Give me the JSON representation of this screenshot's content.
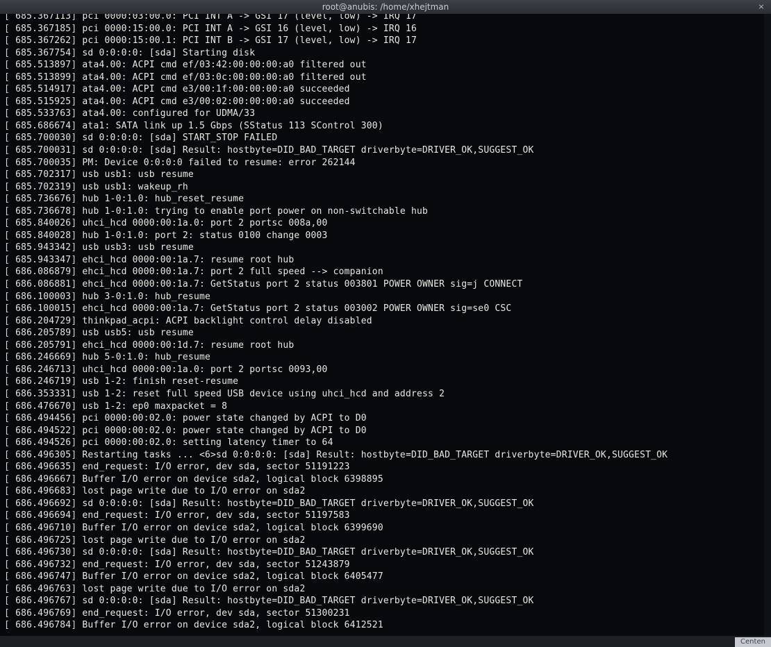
{
  "window": {
    "title": "root@anubis: /home/xhejtman",
    "close_label": "×"
  },
  "status": {
    "corner_label": "Centen"
  },
  "terminal": {
    "lines": [
      {
        "ts": "685.367113",
        "msg": "pci 0000:03:00.0: PCI INT A -> GSI 17 (level, low) -> IRQ 17"
      },
      {
        "ts": "685.367185",
        "msg": "pci 0000:15:00.0: PCI INT A -> GSI 16 (level, low) -> IRQ 16"
      },
      {
        "ts": "685.367262",
        "msg": "pci 0000:15:00.1: PCI INT B -> GSI 17 (level, low) -> IRQ 17"
      },
      {
        "ts": "685.367754",
        "msg": "sd 0:0:0:0: [sda] Starting disk"
      },
      {
        "ts": "685.513897",
        "msg": "ata4.00: ACPI cmd ef/03:42:00:00:00:a0 filtered out"
      },
      {
        "ts": "685.513899",
        "msg": "ata4.00: ACPI cmd ef/03:0c:00:00:00:a0 filtered out"
      },
      {
        "ts": "685.514917",
        "msg": "ata4.00: ACPI cmd e3/00:1f:00:00:00:a0 succeeded"
      },
      {
        "ts": "685.515925",
        "msg": "ata4.00: ACPI cmd e3/00:02:00:00:00:a0 succeeded"
      },
      {
        "ts": "685.533763",
        "msg": "ata4.00: configured for UDMA/33"
      },
      {
        "ts": "685.686674",
        "msg": "ata1: SATA link up 1.5 Gbps (SStatus 113 SControl 300)"
      },
      {
        "ts": "685.700030",
        "msg": "sd 0:0:0:0: [sda] START_STOP FAILED"
      },
      {
        "ts": "685.700031",
        "msg": "sd 0:0:0:0: [sda] Result: hostbyte=DID_BAD_TARGET driverbyte=DRIVER_OK,SUGGEST_OK"
      },
      {
        "ts": "685.700035",
        "msg": "PM: Device 0:0:0:0 failed to resume: error 262144"
      },
      {
        "ts": "685.702317",
        "msg": "usb usb1: usb resume"
      },
      {
        "ts": "685.702319",
        "msg": "usb usb1: wakeup_rh"
      },
      {
        "ts": "685.736676",
        "msg": "hub 1-0:1.0: hub_reset_resume"
      },
      {
        "ts": "685.736678",
        "msg": "hub 1-0:1.0: trying to enable port power on non-switchable hub"
      },
      {
        "ts": "685.840026",
        "msg": "uhci_hcd 0000:00:1a.0: port 2 portsc 008a,00"
      },
      {
        "ts": "685.840028",
        "msg": "hub 1-0:1.0: port 2: status 0100 change 0003"
      },
      {
        "ts": "685.943342",
        "msg": "usb usb3: usb resume"
      },
      {
        "ts": "685.943347",
        "msg": "ehci_hcd 0000:00:1a.7: resume root hub"
      },
      {
        "ts": "686.086879",
        "msg": "ehci_hcd 0000:00:1a.7: port 2 full speed --> companion"
      },
      {
        "ts": "686.086881",
        "msg": "ehci_hcd 0000:00:1a.7: GetStatus port 2 status 003801 POWER OWNER sig=j CONNECT"
      },
      {
        "ts": "686.100003",
        "msg": "hub 3-0:1.0: hub_resume"
      },
      {
        "ts": "686.100015",
        "msg": "ehci_hcd 0000:00:1a.7: GetStatus port 2 status 003002 POWER OWNER sig=se0 CSC"
      },
      {
        "ts": "686.204729",
        "msg": "thinkpad_acpi: ACPI backlight control delay disabled"
      },
      {
        "ts": "686.205789",
        "msg": "usb usb5: usb resume"
      },
      {
        "ts": "686.205791",
        "msg": "ehci_hcd 0000:00:1d.7: resume root hub"
      },
      {
        "ts": "686.246669",
        "msg": "hub 5-0:1.0: hub_resume"
      },
      {
        "ts": "686.246713",
        "msg": "uhci_hcd 0000:00:1a.0: port 2 portsc 0093,00"
      },
      {
        "ts": "686.246719",
        "msg": "usb 1-2: finish reset-resume"
      },
      {
        "ts": "686.353331",
        "msg": "usb 1-2: reset full speed USB device using uhci_hcd and address 2"
      },
      {
        "ts": "686.476670",
        "msg": "usb 1-2: ep0 maxpacket = 8"
      },
      {
        "ts": "686.494456",
        "msg": "pci 0000:00:02.0: power state changed by ACPI to D0"
      },
      {
        "ts": "686.494522",
        "msg": "pci 0000:00:02.0: power state changed by ACPI to D0"
      },
      {
        "ts": "686.494526",
        "msg": "pci 0000:00:02.0: setting latency timer to 64"
      },
      {
        "ts": "686.496305",
        "msg": "Restarting tasks ... <6>sd 0:0:0:0: [sda] Result: hostbyte=DID_BAD_TARGET driverbyte=DRIVER_OK,SUGGEST_OK"
      },
      {
        "ts": "686.496635",
        "msg": "end_request: I/O error, dev sda, sector 51191223"
      },
      {
        "ts": "686.496667",
        "msg": "Buffer I/O error on device sda2, logical block 6398895"
      },
      {
        "ts": "686.496683",
        "msg": "lost page write due to I/O error on sda2"
      },
      {
        "ts": "686.496692",
        "msg": "sd 0:0:0:0: [sda] Result: hostbyte=DID_BAD_TARGET driverbyte=DRIVER_OK,SUGGEST_OK"
      },
      {
        "ts": "686.496694",
        "msg": "end_request: I/O error, dev sda, sector 51197583"
      },
      {
        "ts": "686.496710",
        "msg": "Buffer I/O error on device sda2, logical block 6399690"
      },
      {
        "ts": "686.496725",
        "msg": "lost page write due to I/O error on sda2"
      },
      {
        "ts": "686.496730",
        "msg": "sd 0:0:0:0: [sda] Result: hostbyte=DID_BAD_TARGET driverbyte=DRIVER_OK,SUGGEST_OK"
      },
      {
        "ts": "686.496732",
        "msg": "end_request: I/O error, dev sda, sector 51243879"
      },
      {
        "ts": "686.496747",
        "msg": "Buffer I/O error on device sda2, logical block 6405477"
      },
      {
        "ts": "686.496763",
        "msg": "lost page write due to I/O error on sda2"
      },
      {
        "ts": "686.496767",
        "msg": "sd 0:0:0:0: [sda] Result: hostbyte=DID_BAD_TARGET driverbyte=DRIVER_OK,SUGGEST_OK"
      },
      {
        "ts": "686.496769",
        "msg": "end_request: I/O error, dev sda, sector 51300231"
      },
      {
        "ts": "686.496784",
        "msg": "Buffer I/O error on device sda2, logical block 6412521"
      }
    ]
  }
}
